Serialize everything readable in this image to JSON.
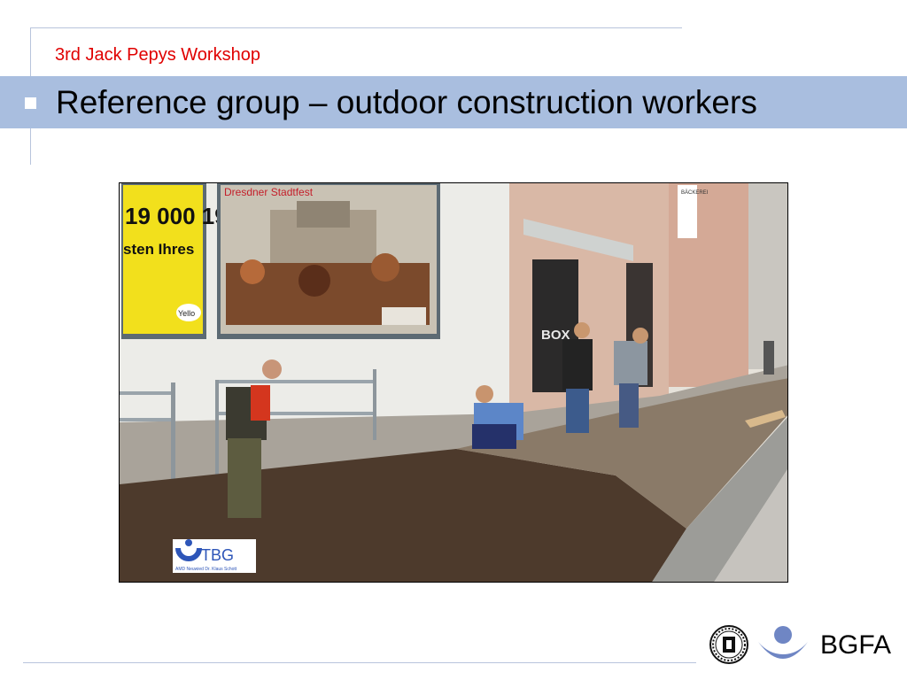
{
  "header": {
    "workshop": "3rd Jack Pepys Workshop",
    "title": "Reference group – outdoor construction workers"
  },
  "photo": {
    "billboard_number": "19 000 19",
    "billboard_text": "sten Ihres",
    "billboard_brand": "Yello",
    "poster_text": "Dresdner Stadtfest",
    "bakery_sign": "BÄCKEREI",
    "shop_sign": "BOX",
    "logo_text": "TBG",
    "logo_caption": "AMD Neuwied Dr. Klaus Schott"
  },
  "footer": {
    "brand": "BGFA"
  },
  "colors": {
    "title_band": "#a9bedf",
    "workshop_text": "#e00000",
    "logo_blue": "#6f86c4"
  }
}
